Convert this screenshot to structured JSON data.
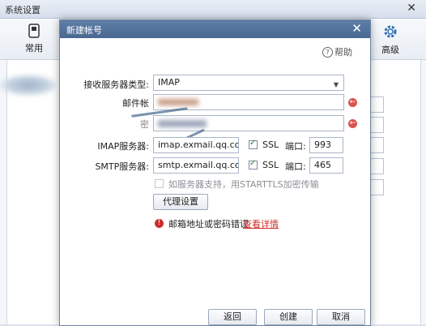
{
  "bg_window": {
    "title": "系统设置",
    "close_glyph": "✕",
    "toolbar": [
      {
        "label": "常用",
        "icon": "phone-icon"
      },
      {
        "label": "高级",
        "icon": "gear-icon"
      }
    ]
  },
  "dialog": {
    "title": "新建帐号",
    "close_glyph": "✕",
    "help": "帮助",
    "server_type_label": "接收服务器类型:",
    "server_type_value": "IMAP",
    "email_label": "邮件帐",
    "password_label": "密",
    "imap_label": "IMAP服务器:",
    "imap_value": "imap.exmail.qq.com",
    "imap_ssl": "SSL",
    "imap_port_label": "端口:",
    "imap_port": "993",
    "smtp_label": "SMTP服务器:",
    "smtp_value": "smtp.exmail.qq.com",
    "smtp_ssl": "SSL",
    "smtp_port_label": "端口:",
    "smtp_port": "465",
    "starttls_label": "如服务器支持，用STARTTLS加密传输",
    "proxy_button": "代理设置",
    "error_text": "邮箱地址或密码错误",
    "error_link": "查看详情",
    "buttons": {
      "back": "返回",
      "create": "创建",
      "cancel": "取消"
    }
  }
}
